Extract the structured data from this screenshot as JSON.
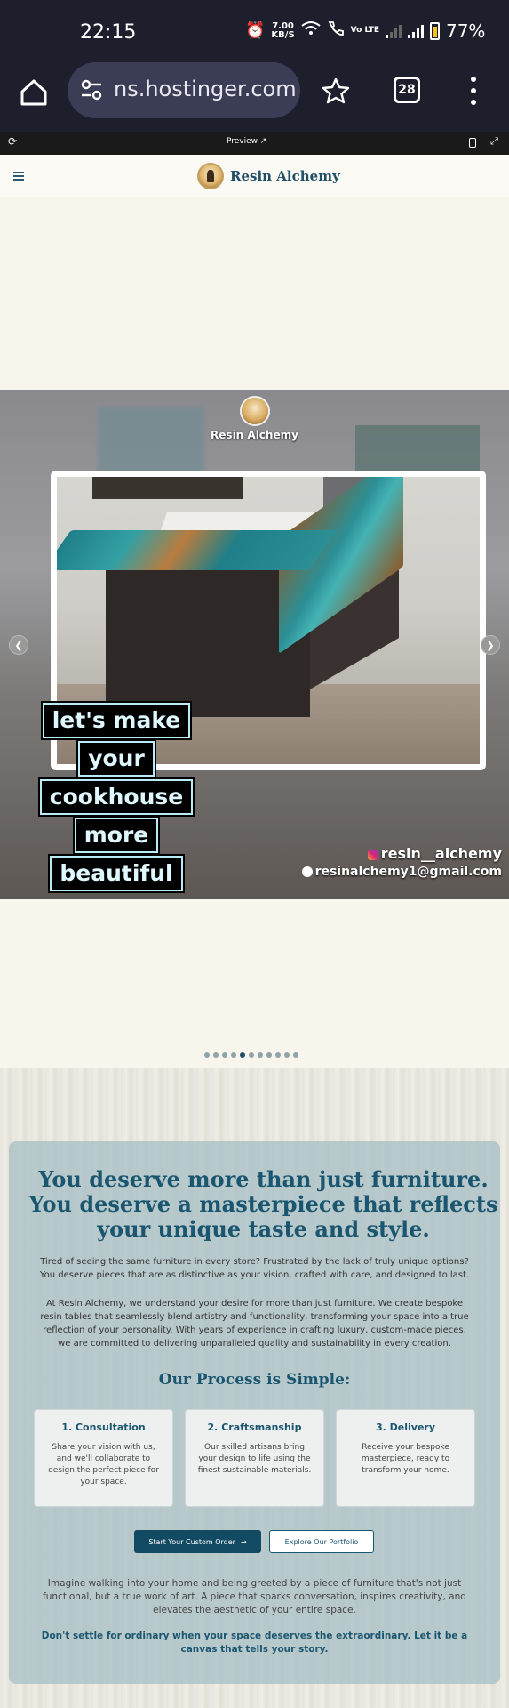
{
  "status_bar": {
    "time": "22:15",
    "net_speed_value": "7.00",
    "net_speed_unit": "KB/S",
    "volte_label": "Vo LTE",
    "battery": "77%"
  },
  "browser": {
    "url_text": "ns.hostinger.com",
    "tab_count": "28"
  },
  "preview_bar": {
    "title": "Preview"
  },
  "site_header": {
    "brand": "Resin Alchemy"
  },
  "slideshow": {
    "brand_name": "Resin Alchemy",
    "headline_lines": [
      "let's make",
      "your",
      "cookhouse",
      "more",
      "beautiful"
    ],
    "instagram": "resin__alchemy",
    "email": "resinalchemy1@gmail.com",
    "dot_count": 11,
    "active_dot": 5
  },
  "content": {
    "hero_title": "You deserve more than just furniture. You deserve a masterpiece that reflects your unique taste and style.",
    "paragraph_1": "Tired of seeing the same furniture in every store? Frustrated by the lack of truly unique options? You deserve pieces that are as distinctive as your vision, crafted with care, and designed to last.",
    "paragraph_2": "At Resin Alchemy, we understand your desire for more than just furniture. We create bespoke resin tables that seamlessly blend artistry and functionality, transforming your space into a true reflection of your personality. With years of experience in crafting luxury, custom-made pieces, we are committed to delivering unparalleled quality and sustainability in every creation.",
    "process_title": "Our Process is Simple:",
    "steps": [
      {
        "title": "1. Consultation",
        "desc": "Share your vision with us, and we'll collaborate to design the perfect piece for your space."
      },
      {
        "title": "2. Craftsmanship",
        "desc": "Our skilled artisans bring your design to life using the finest sustainable materials."
      },
      {
        "title": "3. Delivery",
        "desc": "Receive your bespoke masterpiece, ready to transform your home."
      }
    ],
    "primary_button": "Start Your Custom Order",
    "secondary_button": "Explore Our Portfolio",
    "paragraph_3": "Imagine walking into your home and being greeted by a piece of furniture that's not just functional, but a true work of art. A piece that sparks conversation, inspires creativity, and elevates the aesthetic of your entire space.",
    "paragraph_4": "Don't settle for ordinary when your space deserves the extraordinary. Let it be a canvas that tells your story."
  }
}
